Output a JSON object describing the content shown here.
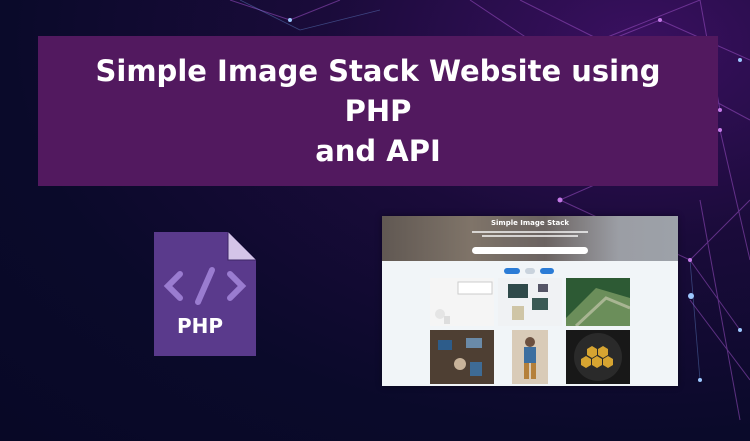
{
  "banner": {
    "title": "Simple Image Stack Website using PHP\nand API"
  },
  "php_icon": {
    "label": "PHP",
    "symbol": "</>"
  },
  "preview": {
    "title": "Simple Image Stack"
  },
  "colors": {
    "banner": "#52195f",
    "background": "#0a0a2a",
    "network_lines": "#b060d0",
    "php_icon": "#5a3a8c",
    "php_fold": "#d4c4e8",
    "accent_blue": "#2b7cd6"
  }
}
